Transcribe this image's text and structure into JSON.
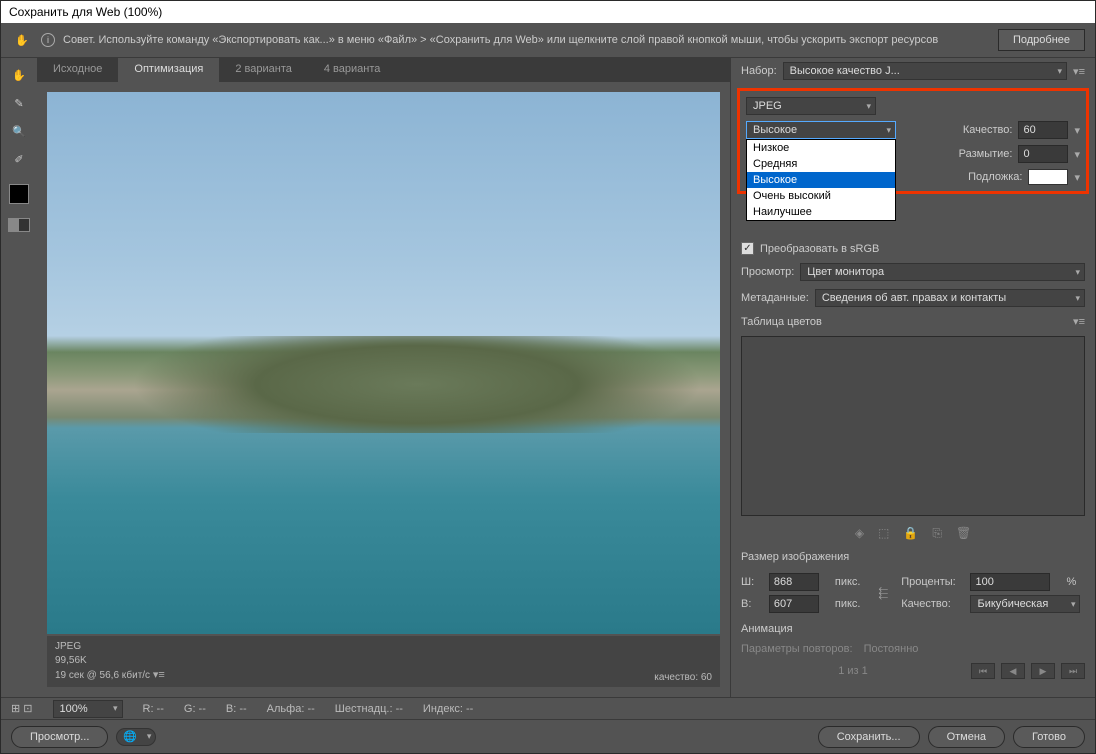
{
  "title": "Сохранить для Web (100%)",
  "tip": {
    "text": "Совет. Используйте команду «Экспортировать как...» в меню «Файл» > «Сохранить для Web» или щелкните слой правой кнопкой мыши, чтобы ускорить экспорт ресурсов",
    "more": "Подробнее"
  },
  "tabs": {
    "source": "Исходное",
    "optimize": "Оптимизация",
    "two": "2 варианта",
    "four": "4 варианта"
  },
  "preset": {
    "label": "Набор:",
    "value": "Высокое качество J..."
  },
  "format": {
    "value": "JPEG"
  },
  "quality_preset": {
    "value": "Высокое",
    "options": [
      "Низкое",
      "Средняя",
      "Высокое",
      "Очень высокий",
      "Наилучшее"
    ]
  },
  "quality": {
    "label": "Качество:",
    "value": "60"
  },
  "blur": {
    "label": "Размытие:",
    "value": "0"
  },
  "matte": {
    "label": "Подложка:"
  },
  "srgb": {
    "label": "Преобразовать в sRGB"
  },
  "preview_mode": {
    "label": "Просмотр:",
    "value": "Цвет монитора"
  },
  "metadata": {
    "label": "Метаданные:",
    "value": "Сведения об авт. правах и контакты"
  },
  "color_table": {
    "title": "Таблица цветов"
  },
  "image_size": {
    "title": "Размер изображения",
    "w_label": "Ш:",
    "w": "868",
    "h_label": "В:",
    "h": "607",
    "px": "пикс.",
    "percent_label": "Проценты:",
    "percent": "100",
    "pct_sign": "%",
    "quality_label": "Качество:",
    "quality": "Бикубическая"
  },
  "animation": {
    "title": "Анимация",
    "loop_label": "Параметры повторов:",
    "loop": "Постоянно",
    "frame": "1 из 1"
  },
  "preview_info": {
    "format": "JPEG",
    "size": "99,56K",
    "time": "19 сек @ 56,6 кбит/с",
    "quality": "качество: 60"
  },
  "status": {
    "zoom": "100%",
    "r": "R: --",
    "g": "G: --",
    "b": "B: --",
    "alpha": "Альфа: --",
    "hex": "Шестнадц.: --",
    "index": "Индекс: --"
  },
  "buttons": {
    "preview": "Просмотр...",
    "save": "Сохранить...",
    "cancel": "Отмена",
    "done": "Готово"
  }
}
